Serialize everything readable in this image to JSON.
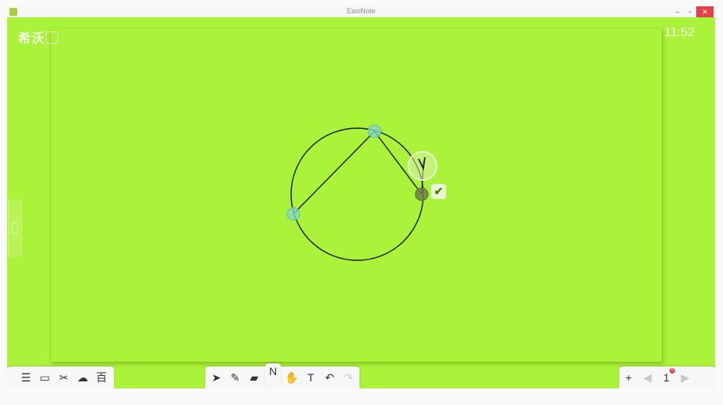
{
  "window": {
    "title": "EasiNote",
    "minimize": "–",
    "maximize": "▫",
    "close": "✕"
  },
  "board": {
    "logo": "希沃",
    "clock": "11:52",
    "background_color": "#abf33a",
    "confirm_icon": "✔"
  },
  "toolbar_left": [
    {
      "name": "menu-icon",
      "glyph": "☰"
    },
    {
      "name": "desktop-icon",
      "glyph": "▭"
    },
    {
      "name": "tools-icon",
      "glyph": "✂"
    },
    {
      "name": "cloud-icon",
      "glyph": "☁"
    },
    {
      "name": "lesson-icon",
      "glyph": "百"
    }
  ],
  "toolbar_center": [
    {
      "name": "select-icon",
      "glyph": "➤"
    },
    {
      "name": "pen-icon",
      "glyph": "✎"
    },
    {
      "name": "eraser-icon",
      "glyph": "▰"
    },
    {
      "name": "shape-icon",
      "glyph": "N",
      "active": true
    },
    {
      "name": "roaming-icon",
      "glyph": "✋"
    },
    {
      "name": "text-icon",
      "glyph": "T"
    },
    {
      "name": "undo-icon",
      "glyph": "↶"
    },
    {
      "name": "redo-icon",
      "glyph": "↷"
    }
  ],
  "toolbar_right": [
    {
      "name": "add-page-icon",
      "glyph": "+"
    },
    {
      "name": "prev-page-icon",
      "glyph": "◀"
    },
    {
      "name": "page-count-icon",
      "glyph": "1",
      "badge": "0"
    },
    {
      "name": "next-page-icon",
      "glyph": "▶"
    }
  ]
}
